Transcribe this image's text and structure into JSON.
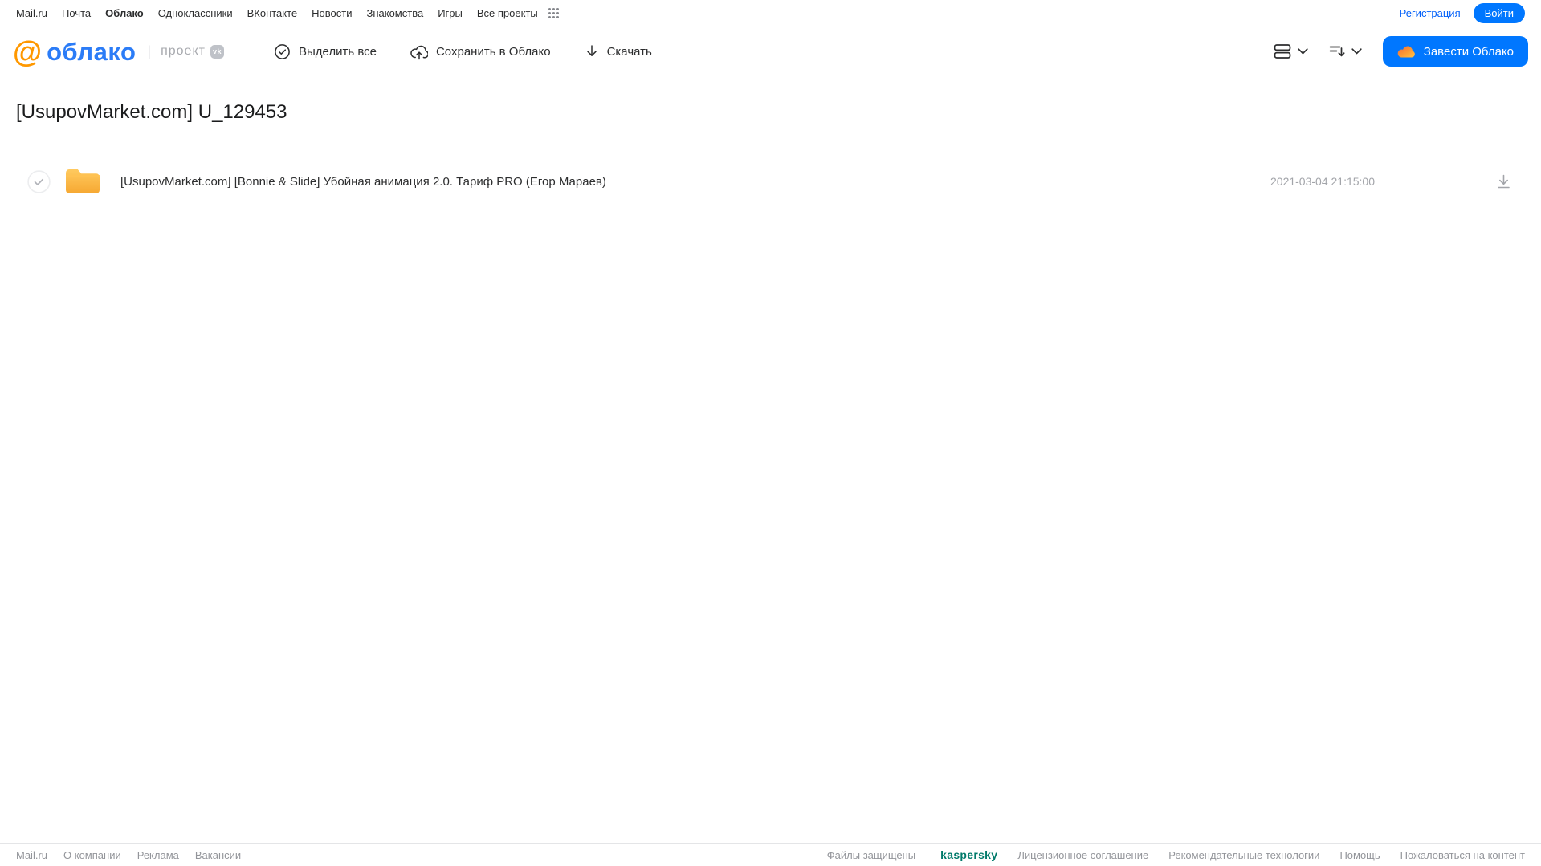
{
  "colors": {
    "accent_blue": "#0077ff",
    "logo_blue": "#2b7cf7",
    "logo_orange": "#ff9800",
    "folder_yellow": "#fcb643",
    "kaspersky_green": "#007a6a",
    "text_dark": "#2c2d2e",
    "text_gray": "#93959a"
  },
  "topnav": {
    "items": [
      {
        "label": "Mail.ru",
        "active": false
      },
      {
        "label": "Почта",
        "active": false
      },
      {
        "label": "Облако",
        "active": true
      },
      {
        "label": "Одноклассники",
        "active": false
      },
      {
        "label": "ВКонтакте",
        "active": false
      },
      {
        "label": "Новости",
        "active": false
      },
      {
        "label": "Знакомства",
        "active": false
      },
      {
        "label": "Игры",
        "active": false
      },
      {
        "label": "Все проекты",
        "active": false
      }
    ],
    "registration_label": "Регистрация",
    "login_label": "Войти"
  },
  "header": {
    "logo_at": "@",
    "logo_text": "облако",
    "project_label": "проект",
    "vk_badge": "vk",
    "toolbar": {
      "select_all": "Выделить все",
      "save_to_cloud": "Сохранить в Облако",
      "download": "Скачать"
    },
    "get_cloud_label": "Завести Облако"
  },
  "main": {
    "title": "[UsupovMarket.com] U_129453",
    "files": [
      {
        "type": "folder",
        "name": "[UsupovMarket.com] [Bonnie & Slide] Убойная анимация 2.0. Тариф PRO (Егор Мараев)",
        "date": "2021-03-04 21:15:00"
      }
    ]
  },
  "footer": {
    "left_links": [
      "Mail.ru",
      "О компании",
      "Реклама",
      "Вакансии"
    ],
    "protected_label": "Файлы защищены",
    "kaspersky_label": "kaspersky",
    "right_links": [
      "Лицензионное соглашение",
      "Рекомендательные технологии",
      "Помощь",
      "Пожаловаться на контент"
    ]
  }
}
